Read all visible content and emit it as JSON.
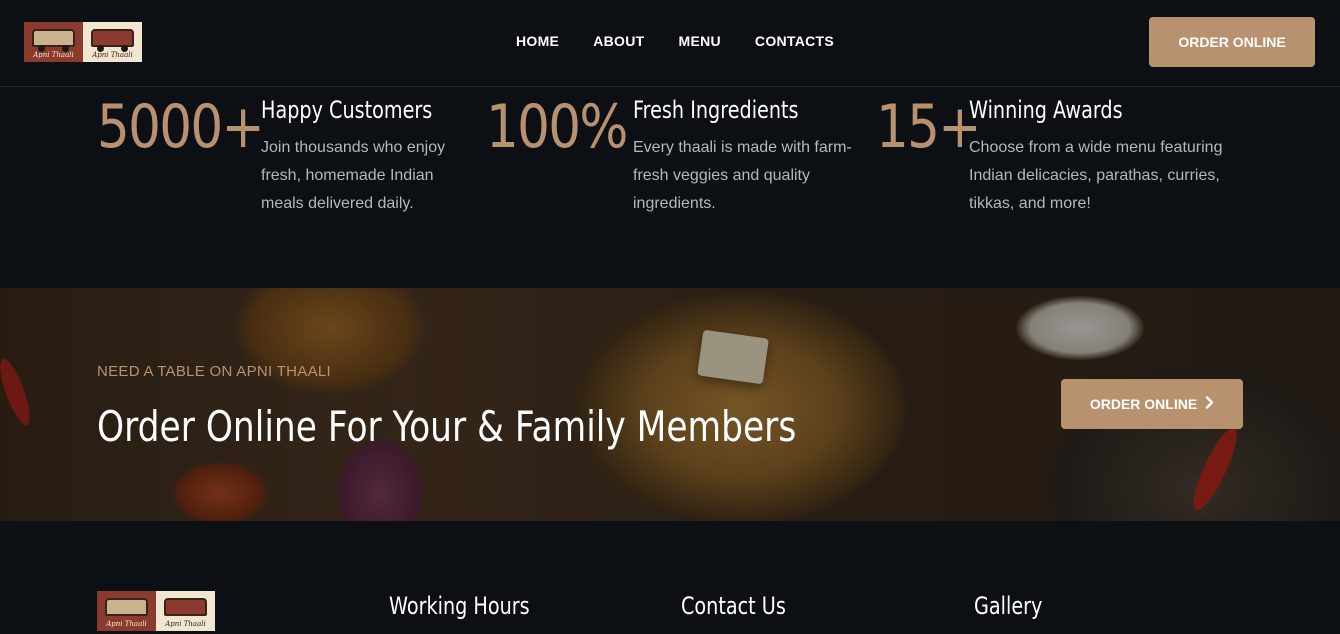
{
  "brand": {
    "logo_text_a": "Apni Thaali",
    "logo_text_b": "Apni Thaali"
  },
  "nav": {
    "items": [
      {
        "label": "HOME"
      },
      {
        "label": "ABOUT"
      },
      {
        "label": "MENU"
      },
      {
        "label": "CONTACTS"
      }
    ],
    "order_label": "ORDER ONLINE"
  },
  "stats": [
    {
      "value": "5000+",
      "title": "Happy Customers",
      "desc_lines": [
        "Join thousands who enjoy",
        "fresh, homemade Indian",
        "meals delivered daily."
      ]
    },
    {
      "value": "100%",
      "title": "Fresh Ingredients",
      "desc_lines": [
        "Every thaali is made with farm-",
        "fresh veggies and quality",
        "ingredients."
      ]
    },
    {
      "value": "15+",
      "title": "Winning Awards",
      "desc_lines": [
        "Choose from a wide menu featuring",
        "Indian delicacies, parathas, curries,",
        "tikkas, and more!"
      ]
    }
  ],
  "banner": {
    "kicker": "NEED A TABLE ON APNI THAALI",
    "title": "Order Online For Your & Family Members",
    "button_label": "ORDER ONLINE"
  },
  "footer": {
    "headings": {
      "working_hours": "Working Hours",
      "contact_us": "Contact Us",
      "gallery": "Gallery"
    }
  },
  "colors": {
    "accent": "#b8916f",
    "background": "#0c1015"
  }
}
